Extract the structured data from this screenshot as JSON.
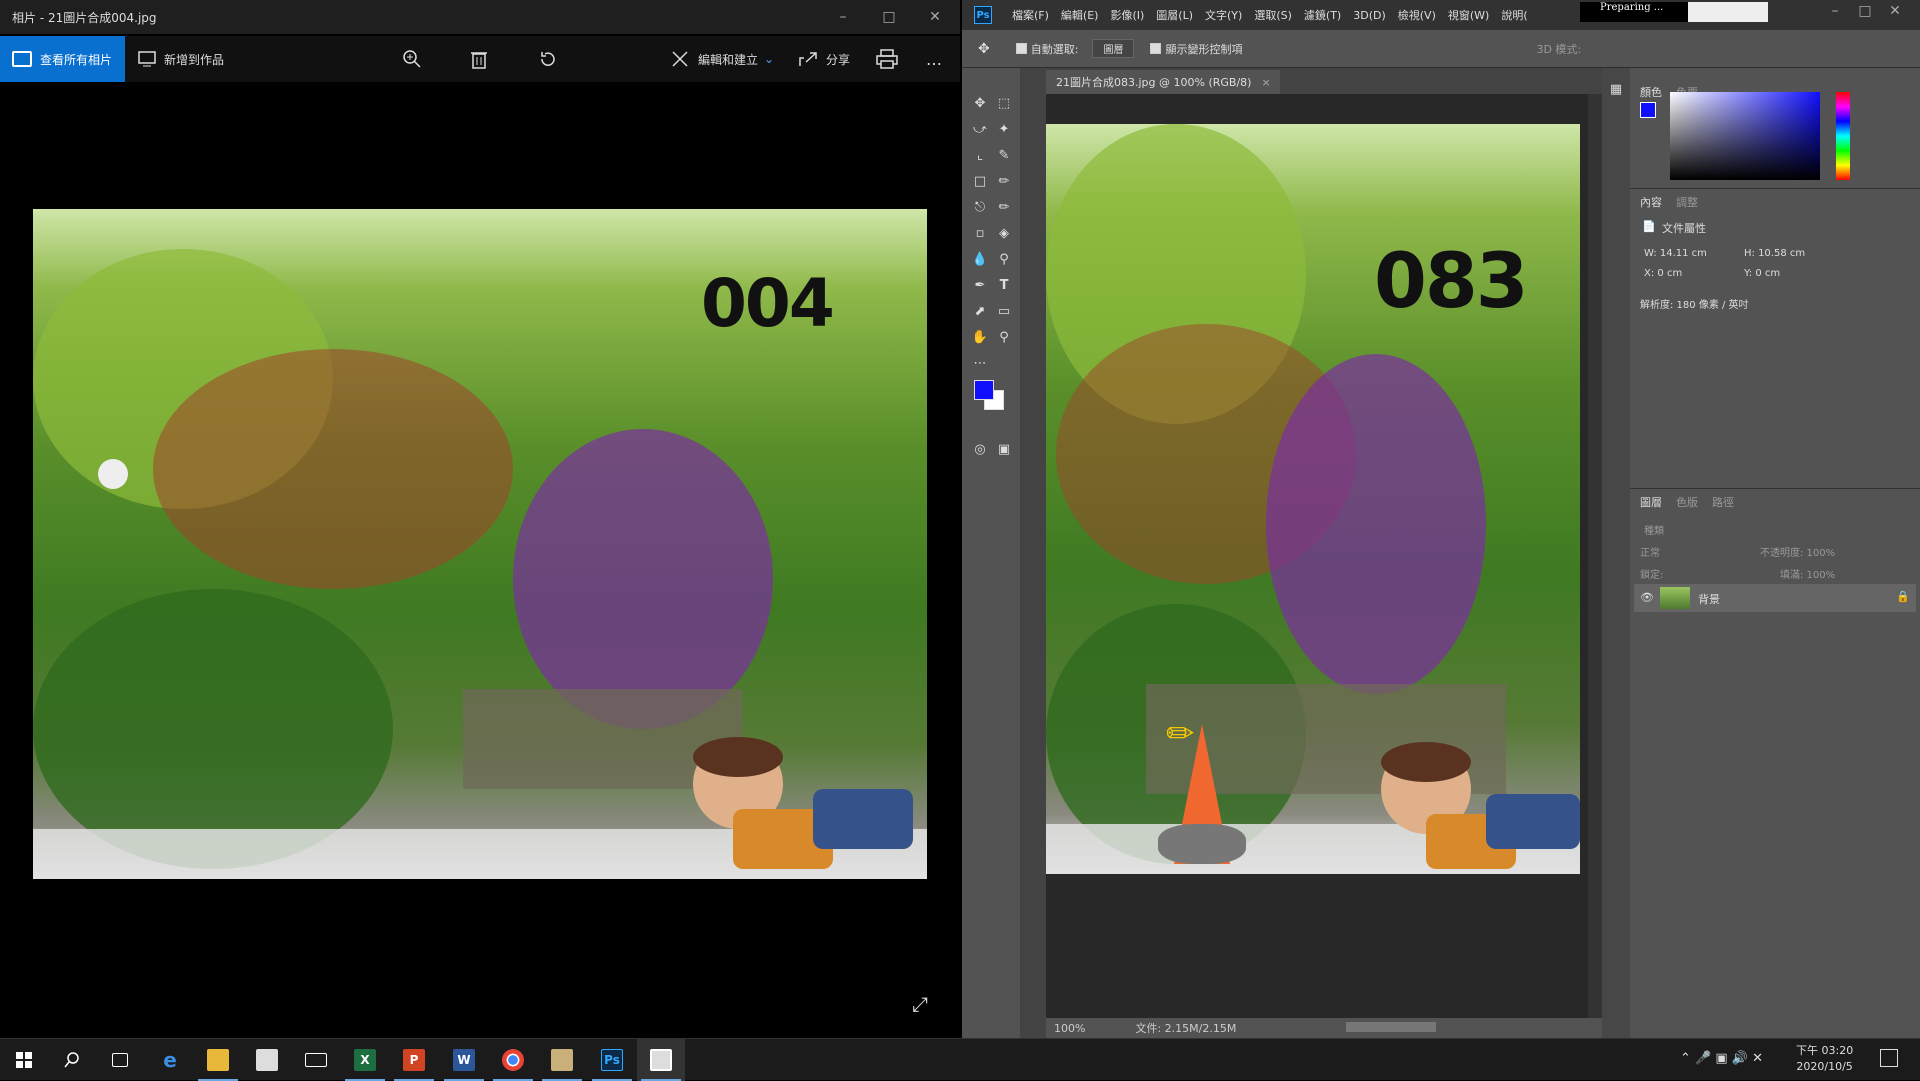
{
  "photos": {
    "title": "相片 - 21圖片合成004.jpg",
    "view_all": "查看所有相片",
    "add_to_creation": "新增到作品",
    "edit_create": "編輯和建立",
    "share": "分享",
    "more": "…",
    "photo_number": "004"
  },
  "ps": {
    "menu": [
      "檔案(F)",
      "編輯(E)",
      "影像(I)",
      "圖層(L)",
      "文字(Y)",
      "選取(S)",
      "濾鏡(T)",
      "3D(D)",
      "檢視(V)",
      "視窗(W)",
      "說明("
    ],
    "preparing": "Preparing ...",
    "auto_select": "自動選取:",
    "auto_select_value": "圖層",
    "show_transform": "顯示變形控制項",
    "mode_3d": "3D 模式:",
    "doc_tab": "21圖片合成083.jpg @ 100% (RGB/8)",
    "photo_number": "083",
    "zoom": "100%",
    "doc_size": "文件: 2.15M/2.15M",
    "color_tabs": [
      "顏色",
      "色票"
    ],
    "prop_tabs": [
      "內容",
      "調整"
    ],
    "doc_props": "文件屬性",
    "w": "W:  14.11 cm",
    "h": "H:  10.58 cm",
    "x": "X:  0 cm",
    "y": "Y:  0 cm",
    "resolution": "解析度: 180 像素 / 英吋",
    "layer_tabs": [
      "圖層",
      "色版",
      "路徑"
    ],
    "kind": "種類",
    "blend": "正常",
    "opacity": "不透明度: 100%",
    "lock": "鎖定:",
    "fill": "填滿: 100%",
    "layer_name": "背景",
    "fg_color": "#1010ff",
    "bg_color": "#ffffff"
  },
  "taskbar": {
    "time": "下午 03:20",
    "date": "2020/10/5"
  }
}
